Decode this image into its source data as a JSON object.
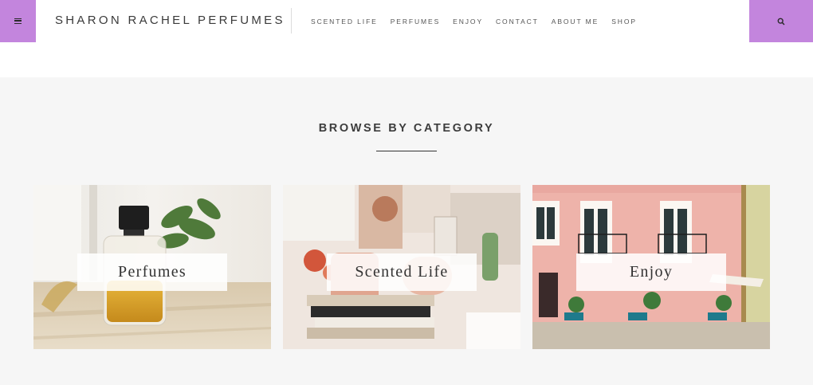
{
  "header": {
    "logo": "SHARON RACHEL PERFUMES",
    "menu_icon": "hamburger-icon",
    "search_icon": "search-icon",
    "nav": [
      {
        "label": "SCENTED LIFE"
      },
      {
        "label": "PERFUMES"
      },
      {
        "label": "ENJOY"
      },
      {
        "label": "CONTACT"
      },
      {
        "label": "ABOUT ME"
      },
      {
        "label": "SHOP"
      }
    ]
  },
  "browse": {
    "title": "BROWSE BY CATEGORY",
    "categories": [
      {
        "label": "Perfumes"
      },
      {
        "label": "Scented Life"
      },
      {
        "label": "Enjoy"
      }
    ]
  },
  "colors": {
    "accent": "#c385dd",
    "section_bg": "#f6f6f6"
  }
}
